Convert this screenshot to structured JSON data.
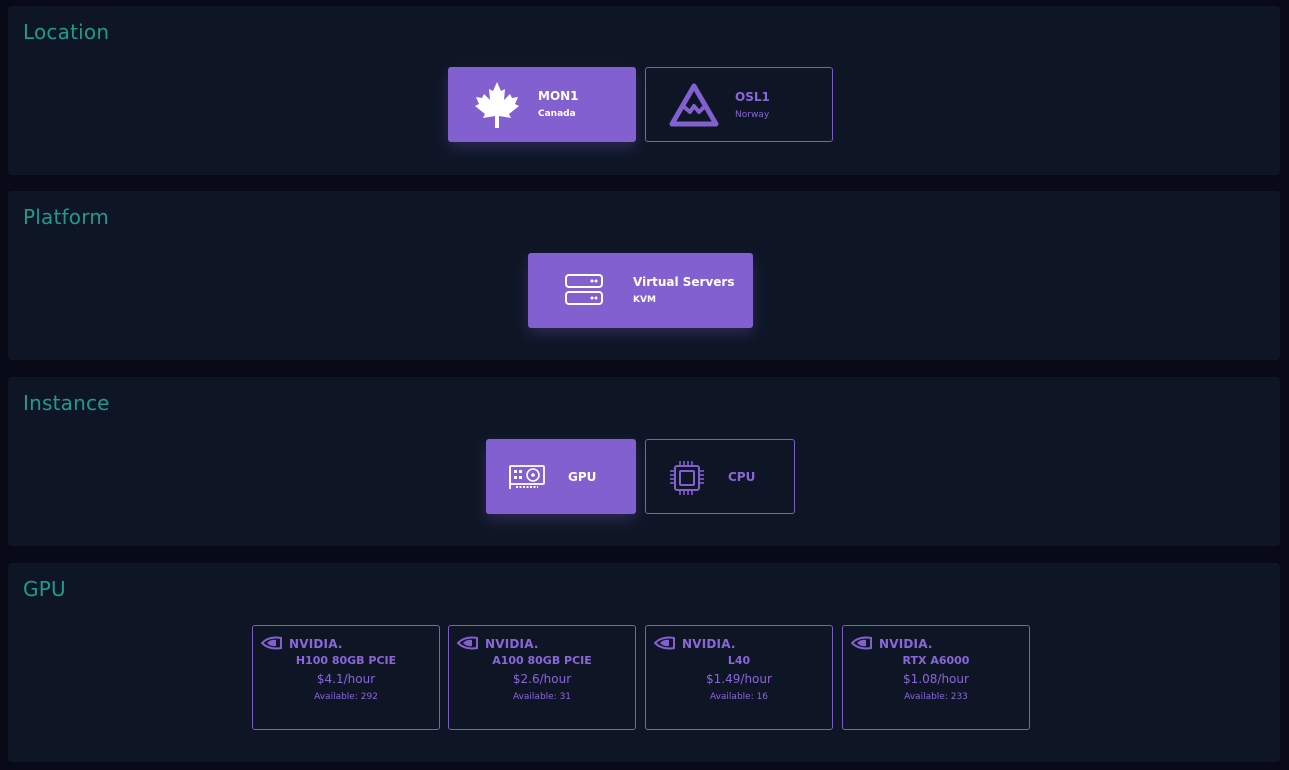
{
  "colors": {
    "page_bg": "#080a18",
    "panel_bg": "#0e1626",
    "section_title": "#1f9a8c",
    "accent": "#8360cf",
    "accent_text": "#8a66da"
  },
  "sections": {
    "location": {
      "title": "Location",
      "options": [
        {
          "name": "MON1",
          "sub": "Canada",
          "icon": "maple-leaf-icon",
          "selected": true
        },
        {
          "name": "OSL1",
          "sub": "Norway",
          "icon": "mountain-icon",
          "selected": false
        }
      ]
    },
    "platform": {
      "title": "Platform",
      "options": [
        {
          "name": "Virtual Servers",
          "sub": "KVM",
          "icon": "server-icon",
          "selected": true
        }
      ]
    },
    "instance": {
      "title": "Instance",
      "options": [
        {
          "name": "GPU",
          "icon": "graphics-card-icon",
          "selected": true
        },
        {
          "name": "CPU",
          "icon": "cpu-chip-icon",
          "selected": false
        }
      ]
    },
    "gpu": {
      "title": "GPU",
      "options": [
        {
          "brand": "NVIDIA.",
          "model": "H100 80GB PCIE",
          "price": "$4.1/hour",
          "available": "Available: 292"
        },
        {
          "brand": "NVIDIA.",
          "model": "A100 80GB PCIE",
          "price": "$2.6/hour",
          "available": "Available: 31"
        },
        {
          "brand": "NVIDIA.",
          "model": "L40",
          "price": "$1.49/hour",
          "available": "Available: 16"
        },
        {
          "brand": "NVIDIA.",
          "model": "RTX A6000",
          "price": "$1.08/hour",
          "available": "Available: 233"
        }
      ]
    }
  }
}
